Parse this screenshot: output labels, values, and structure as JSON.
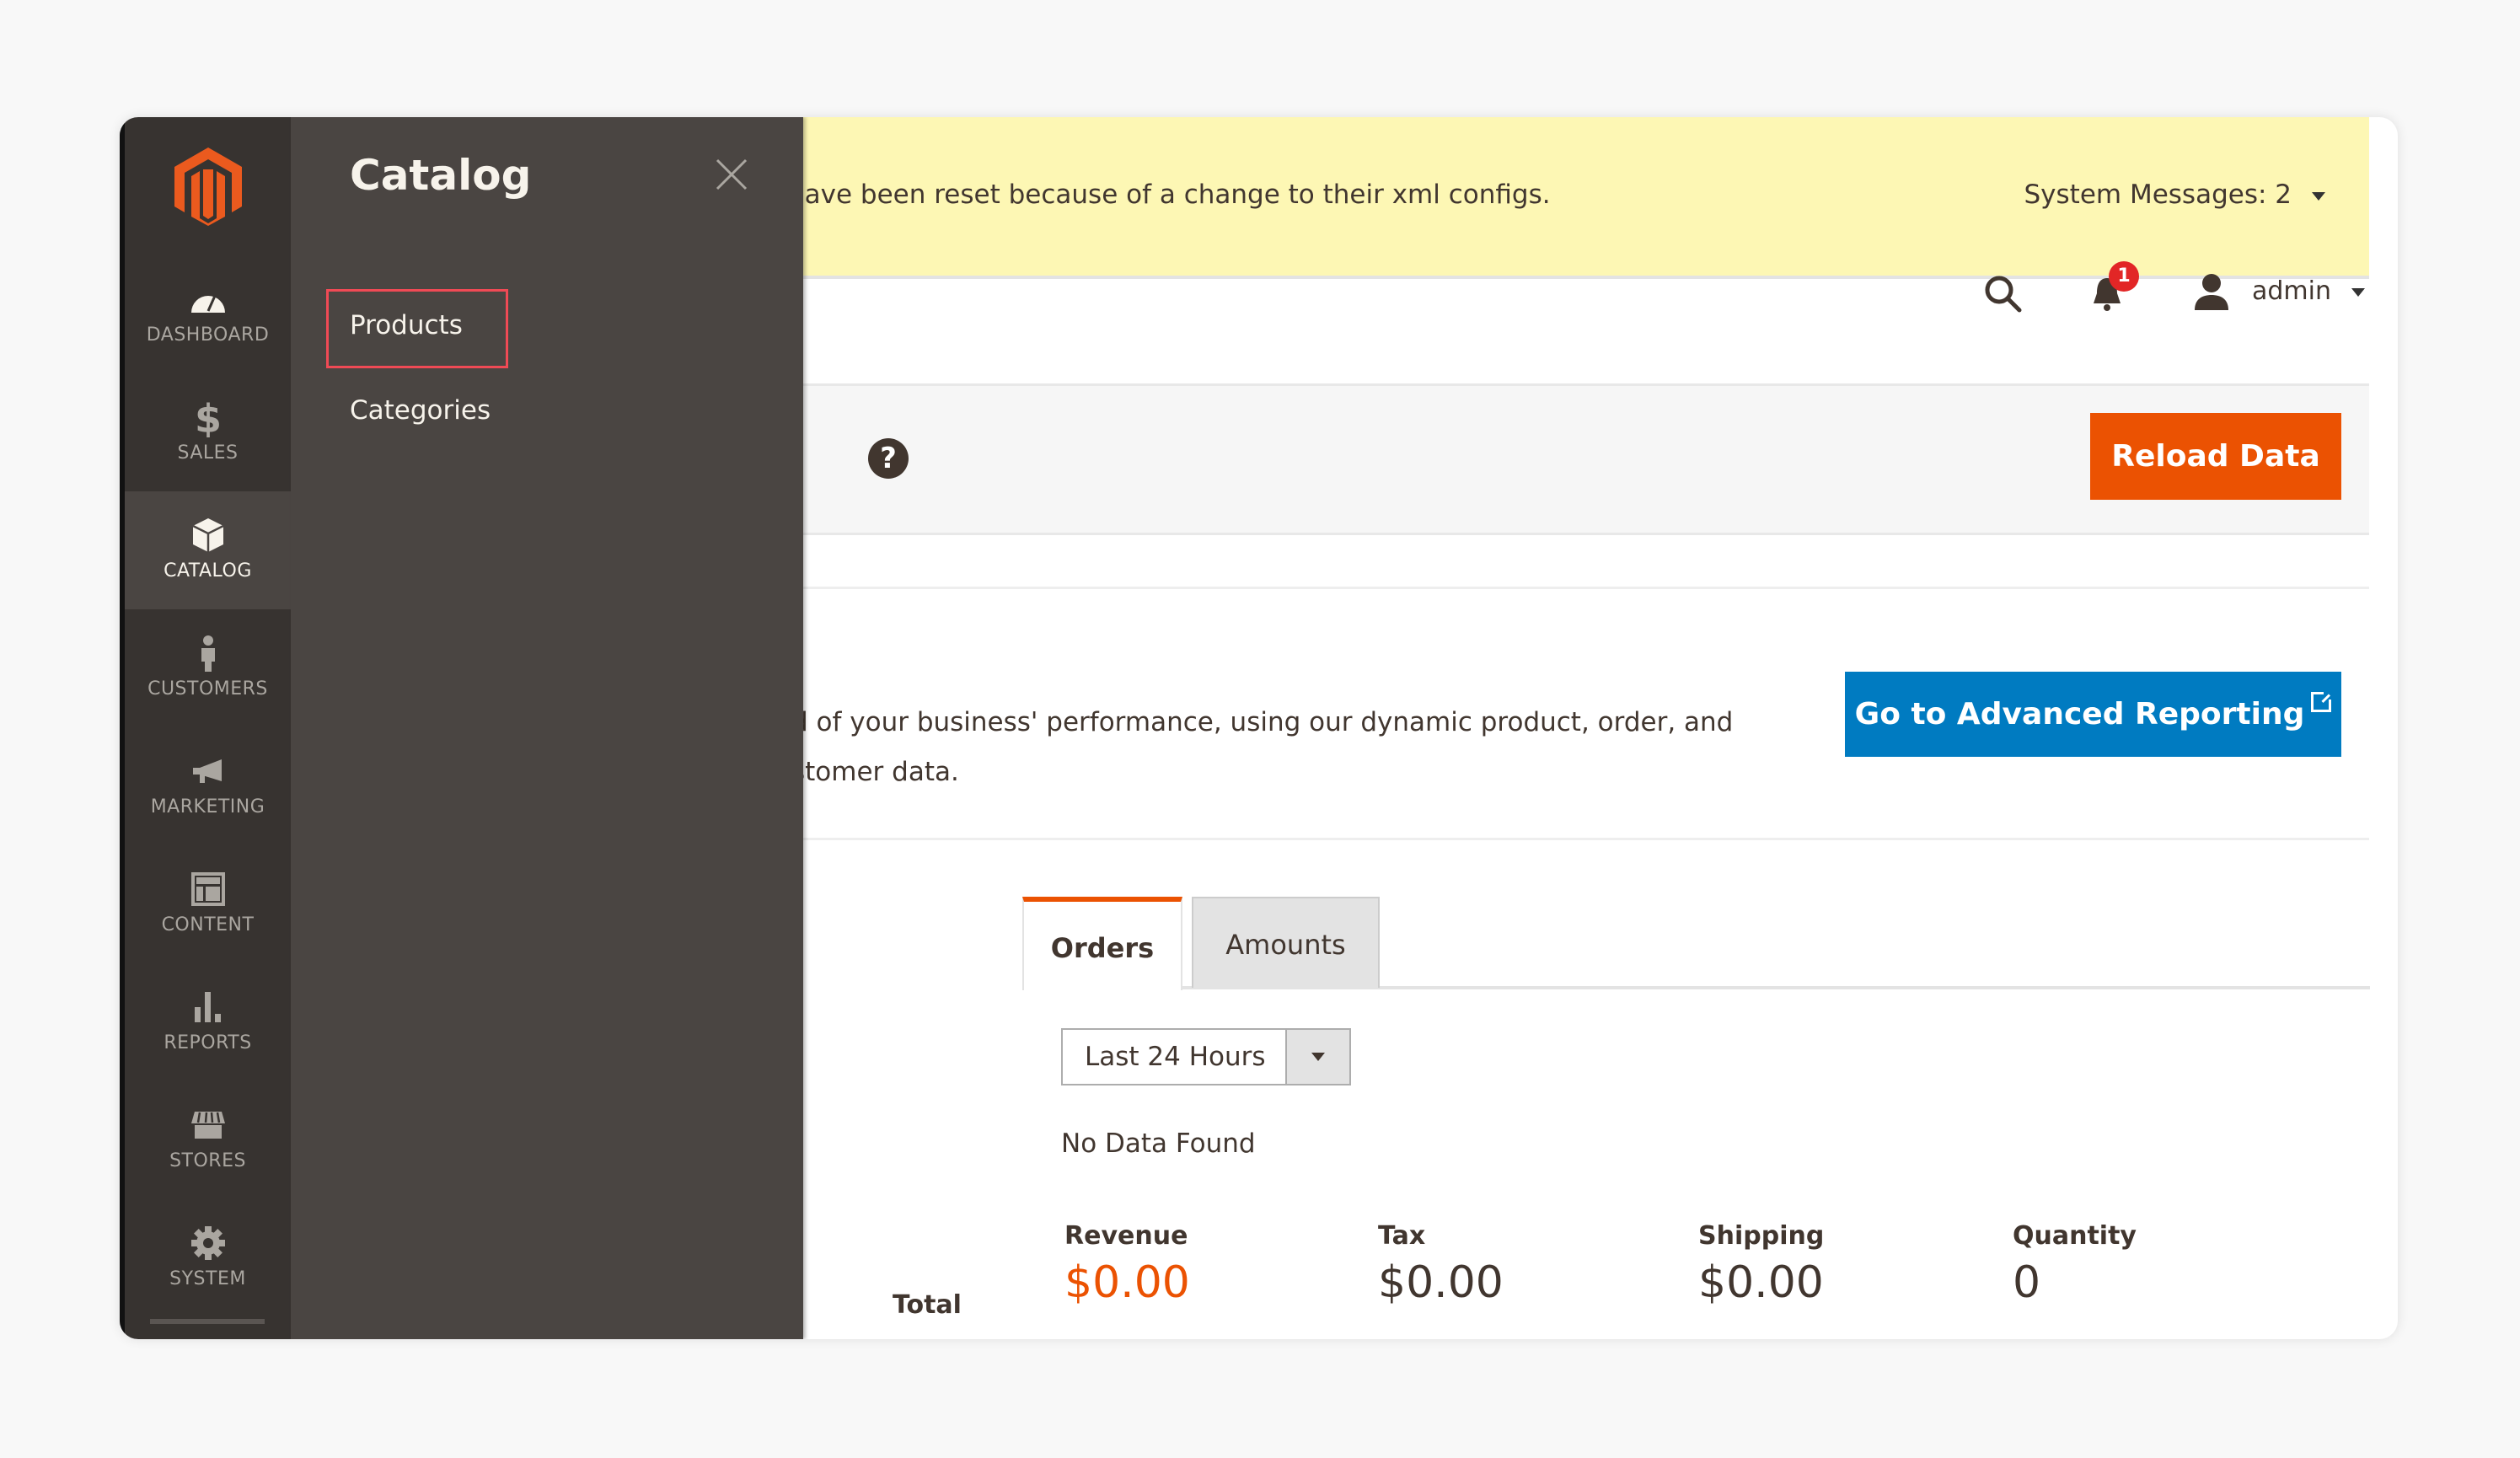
{
  "messages": {
    "text": "have been reset because of a change to their xml configs.",
    "system_messages_label": "System Messages: 2"
  },
  "header": {
    "notifications_count": "1",
    "user_label": "admin"
  },
  "page_actions": {
    "reload_label": "Reload Data"
  },
  "advanced_reporting": {
    "line1": "d of your business' performance, using our dynamic product, order, and",
    "line2": "stomer data.",
    "button_label": "Go to Advanced Reporting"
  },
  "dashboard": {
    "tabs": [
      {
        "label": "Orders",
        "active": true
      },
      {
        "label": "Amounts",
        "active": false
      }
    ],
    "period_select": {
      "value": "Last 24 Hours"
    },
    "no_data_text": "No Data Found",
    "totals_label": "Total",
    "stats": [
      {
        "label": "Revenue",
        "value": "$0.00"
      },
      {
        "label": "Tax",
        "value": "$0.00"
      },
      {
        "label": "Shipping",
        "value": "$0.00"
      },
      {
        "label": "Quantity",
        "value": "0"
      }
    ]
  },
  "nav": {
    "items": [
      {
        "label": "DASHBOARD",
        "icon": "dashboard-icon"
      },
      {
        "label": "SALES",
        "icon": "dollar-icon"
      },
      {
        "label": "CATALOG",
        "icon": "box-icon",
        "active": true
      },
      {
        "label": "CUSTOMERS",
        "icon": "person-icon"
      },
      {
        "label": "MARKETING",
        "icon": "megaphone-icon"
      },
      {
        "label": "CONTENT",
        "icon": "layout-icon"
      },
      {
        "label": "REPORTS",
        "icon": "bar-chart-icon"
      },
      {
        "label": "STORES",
        "icon": "storefront-icon"
      },
      {
        "label": "SYSTEM",
        "icon": "gear-icon"
      }
    ]
  },
  "flyout": {
    "title": "Catalog",
    "links": [
      {
        "label": "Products",
        "highlighted": true
      },
      {
        "label": "Categories"
      }
    ]
  },
  "colors": {
    "accent_orange": "#eb5202",
    "primary_blue": "#007bc1",
    "nav_dark": "#373330",
    "flyout_bg": "#4a4542",
    "message_bar": "#fdf7b4",
    "highlight_border": "#f04a55",
    "badge_red": "#e22626"
  }
}
